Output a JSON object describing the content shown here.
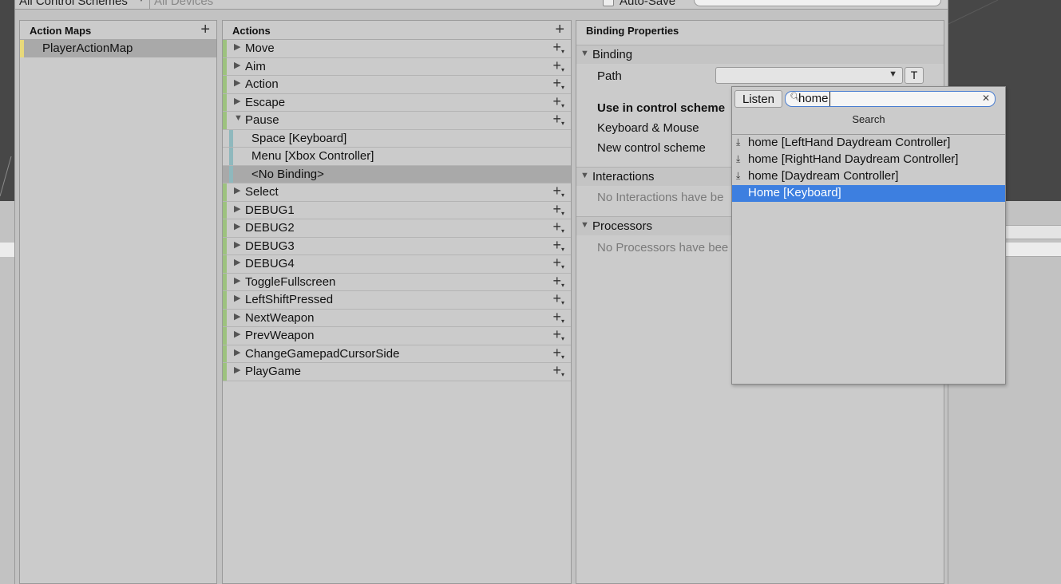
{
  "toolbar": {
    "control_schemes": "All Control Schemes",
    "devices": "All Devices",
    "auto_save": "Auto-Save"
  },
  "action_maps": {
    "header": "Action Maps",
    "items": [
      "PlayerActionMap"
    ]
  },
  "actions": {
    "header": "Actions",
    "items": [
      {
        "label": "Move"
      },
      {
        "label": "Aim"
      },
      {
        "label": "Action"
      },
      {
        "label": "Escape"
      },
      {
        "label": "Pause"
      },
      {
        "label": "Space [Keyboard]"
      },
      {
        "label": "Menu [Xbox Controller]"
      },
      {
        "label": "<No Binding>"
      },
      {
        "label": "Select"
      },
      {
        "label": "DEBUG1"
      },
      {
        "label": "DEBUG2"
      },
      {
        "label": "DEBUG3"
      },
      {
        "label": "DEBUG4"
      },
      {
        "label": "ToggleFullscreen"
      },
      {
        "label": "LeftShiftPressed"
      },
      {
        "label": "NextWeapon"
      },
      {
        "label": "PrevWeapon"
      },
      {
        "label": "ChangeGamepadCursorSide"
      },
      {
        "label": "PlayGame"
      }
    ]
  },
  "binding_properties": {
    "header": "Binding Properties",
    "binding_section": "Binding",
    "path_label": "Path",
    "t_button": "T",
    "use_in_control_scheme": "Use in control scheme",
    "schemes": [
      "Keyboard & Mouse",
      "New control scheme"
    ],
    "interactions_section": "Interactions",
    "interactions_empty": "No Interactions have be",
    "processors_section": "Processors",
    "processors_empty": "No Processors have bee"
  },
  "popup": {
    "listen_label": "Listen",
    "search_value": "home",
    "title": "Search",
    "results": [
      "home [LeftHand Daydream Controller]",
      "home [RightHand Daydream Controller]",
      "home [Daydream Controller]",
      "Home [Keyboard]"
    ],
    "selected_index": 3
  },
  "colors": {
    "selection": "#3d7fe0",
    "action_stripe": "#9dc27e",
    "binding_stripe": "#8fb8bd",
    "map_stripe": "#e8d97a"
  }
}
